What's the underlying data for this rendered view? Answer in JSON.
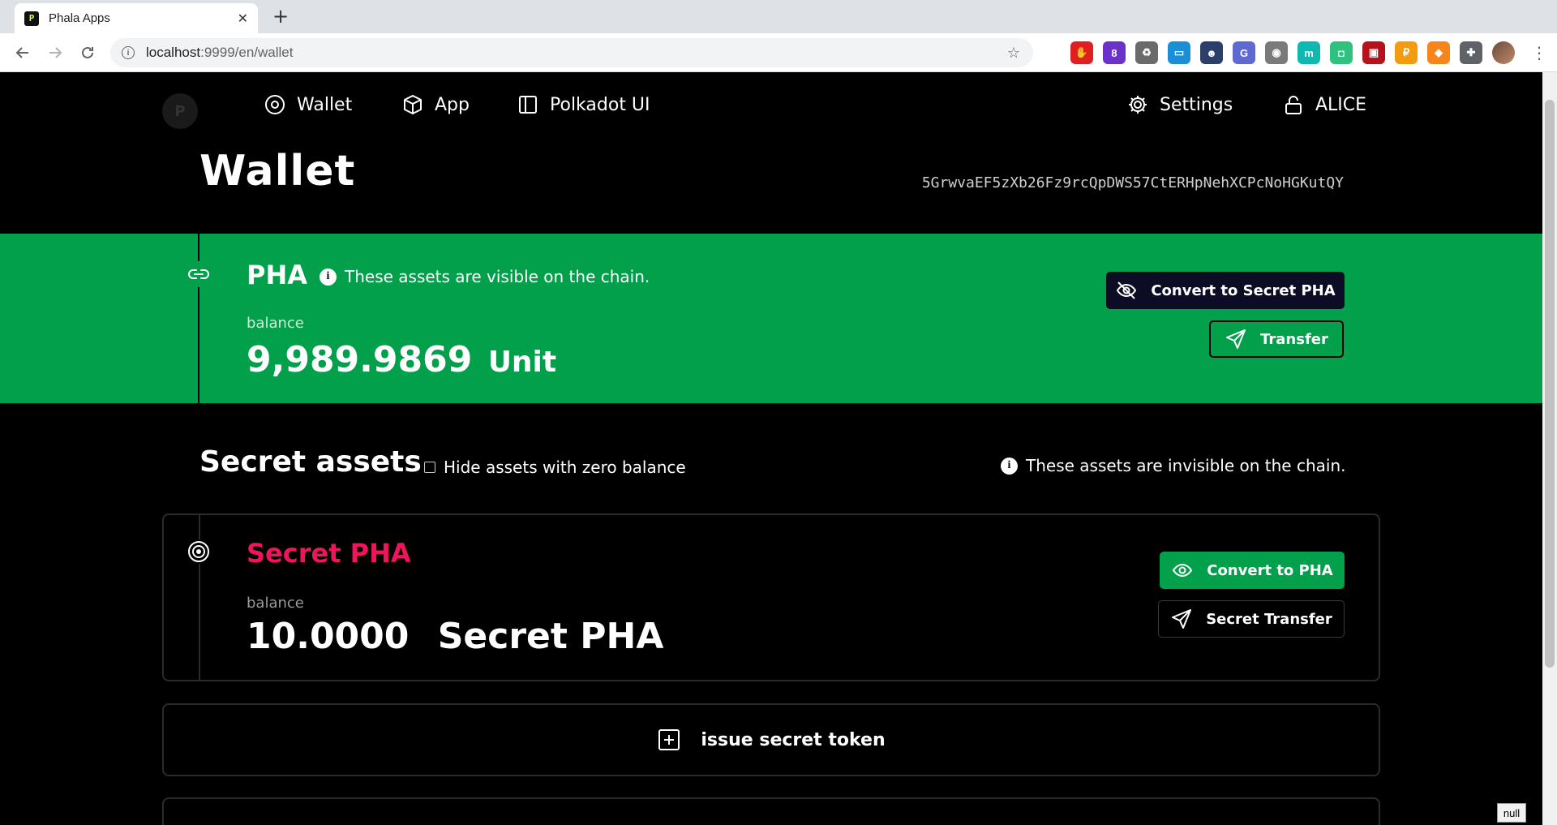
{
  "browser": {
    "tab_title": "Phala Apps",
    "tab_favicon": "P",
    "tab_close": "✕",
    "new_tab": "+",
    "url_host": "localhost",
    "url_path": ":9999/en/wallet",
    "extensions": [
      {
        "name": "ublock-icon",
        "color": "#e02020",
        "glyph": "✋"
      },
      {
        "name": "graduation-cap-icon",
        "color": "#6a32c9",
        "glyph": "8"
      },
      {
        "name": "recycle-icon",
        "color": "#6b6b6b",
        "glyph": "♻"
      },
      {
        "name": "window-icon",
        "color": "#1a8fd6",
        "glyph": "▭"
      },
      {
        "name": "spy-icon",
        "color": "#2c3e6a",
        "glyph": "☻"
      },
      {
        "name": "translate-icon",
        "color": "#5e6ad2",
        "glyph": "G"
      },
      {
        "name": "contact-icon",
        "color": "#7a7a7a",
        "glyph": "◉"
      },
      {
        "name": "m-icon",
        "color": "#0fb9b1",
        "glyph": "m"
      },
      {
        "name": "tile-icon",
        "color": "#2ec27e",
        "glyph": "◘"
      },
      {
        "name": "fort-icon",
        "color": "#b5121b",
        "glyph": "▣"
      },
      {
        "name": "coin-icon",
        "color": "#f39c12",
        "glyph": "₽"
      },
      {
        "name": "metamask-icon",
        "color": "#f6851b",
        "glyph": "◆"
      },
      {
        "name": "puzzle-icon",
        "color": "#5f6368",
        "glyph": "✚"
      }
    ],
    "menu": "⋮",
    "star": "☆"
  },
  "nav": {
    "wallet": "Wallet",
    "app": "App",
    "polkadot_ui": "Polkadot UI",
    "settings": "Settings",
    "account": "ALICE"
  },
  "page": {
    "title": "Wallet",
    "address": "5GrwvaEF5zXb26Fz9rcQpDWS57CtERHpNehXCPcNoHGKutQY"
  },
  "pha": {
    "title": "PHA",
    "info_icon": "i",
    "info": "These assets are visible on the chain.",
    "balance_label": "balance",
    "balance": "9,989.9869",
    "unit": "Unit",
    "convert_label": "Convert to Secret PHA",
    "transfer_label": "Transfer"
  },
  "secret": {
    "title": "Secret assets",
    "hide_zero_label": "Hide assets with zero balance",
    "info_icon": "i",
    "info": "These assets are invisible on the chain.",
    "asset": {
      "name": "Secret PHA",
      "balance_label": "balance",
      "balance": "10.0000",
      "unit": "Secret PHA",
      "convert_label": "Convert to PHA",
      "transfer_label": "Secret Transfer"
    },
    "issue_label": "issue secret token"
  },
  "debug": {
    "null_badge": "null"
  },
  "colors": {
    "pha_band": "#03a04b",
    "secret_accent": "#f0145a",
    "dark_button": "#0c0c24"
  }
}
